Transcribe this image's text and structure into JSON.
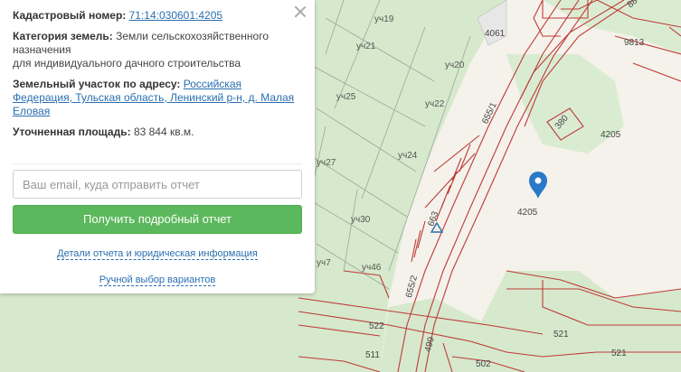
{
  "panel": {
    "cadastral_label": "Кадастровый номер:",
    "cadastral_number": "71:14:030601:4205",
    "category_label": "Категория земель:",
    "category_value_1": "Земли сельскохозяйственного назначения",
    "category_value_2": "для индивидуального дачного строительства",
    "address_label": "Земельный участок по адресу:",
    "address_value": "Российская Федерация, Тульская область, Ленинский р-н, д. Малая Еловая",
    "area_label": "Уточненная площадь:",
    "area_value": "83 844 кв.м.",
    "email_placeholder": "Ваш email, куда отправить отчет",
    "report_button": "Получить подробный отчет",
    "details_link": "Детали отчета и юридическая информация",
    "manual_link": "Ручной выбор вариантов"
  },
  "map_labels": {
    "uch19": "уч19",
    "uch21": "уч21",
    "uch20": "уч20",
    "uch25": "уч25",
    "uch22": "уч22",
    "uch27": "уч27",
    "uch24": "уч24",
    "uch30": "уч30",
    "uch7": "уч7",
    "uch46": "уч46",
    "p4061": "4061",
    "p9813": "9813",
    "p380": "380",
    "p4205a": "4205",
    "p4205b": "4205",
    "p655_1": "655/1",
    "p663": "663",
    "p655_2": "655/2",
    "p522": "522",
    "p511": "511",
    "p499": "499",
    "p502": "502",
    "p521a": "521",
    "p521b": "521",
    "p88": "88"
  },
  "colors": {
    "green_zone": "#d7ead0",
    "boundary": "#c03a3a",
    "marker": "#2a78c8",
    "button": "#5cb85c"
  }
}
